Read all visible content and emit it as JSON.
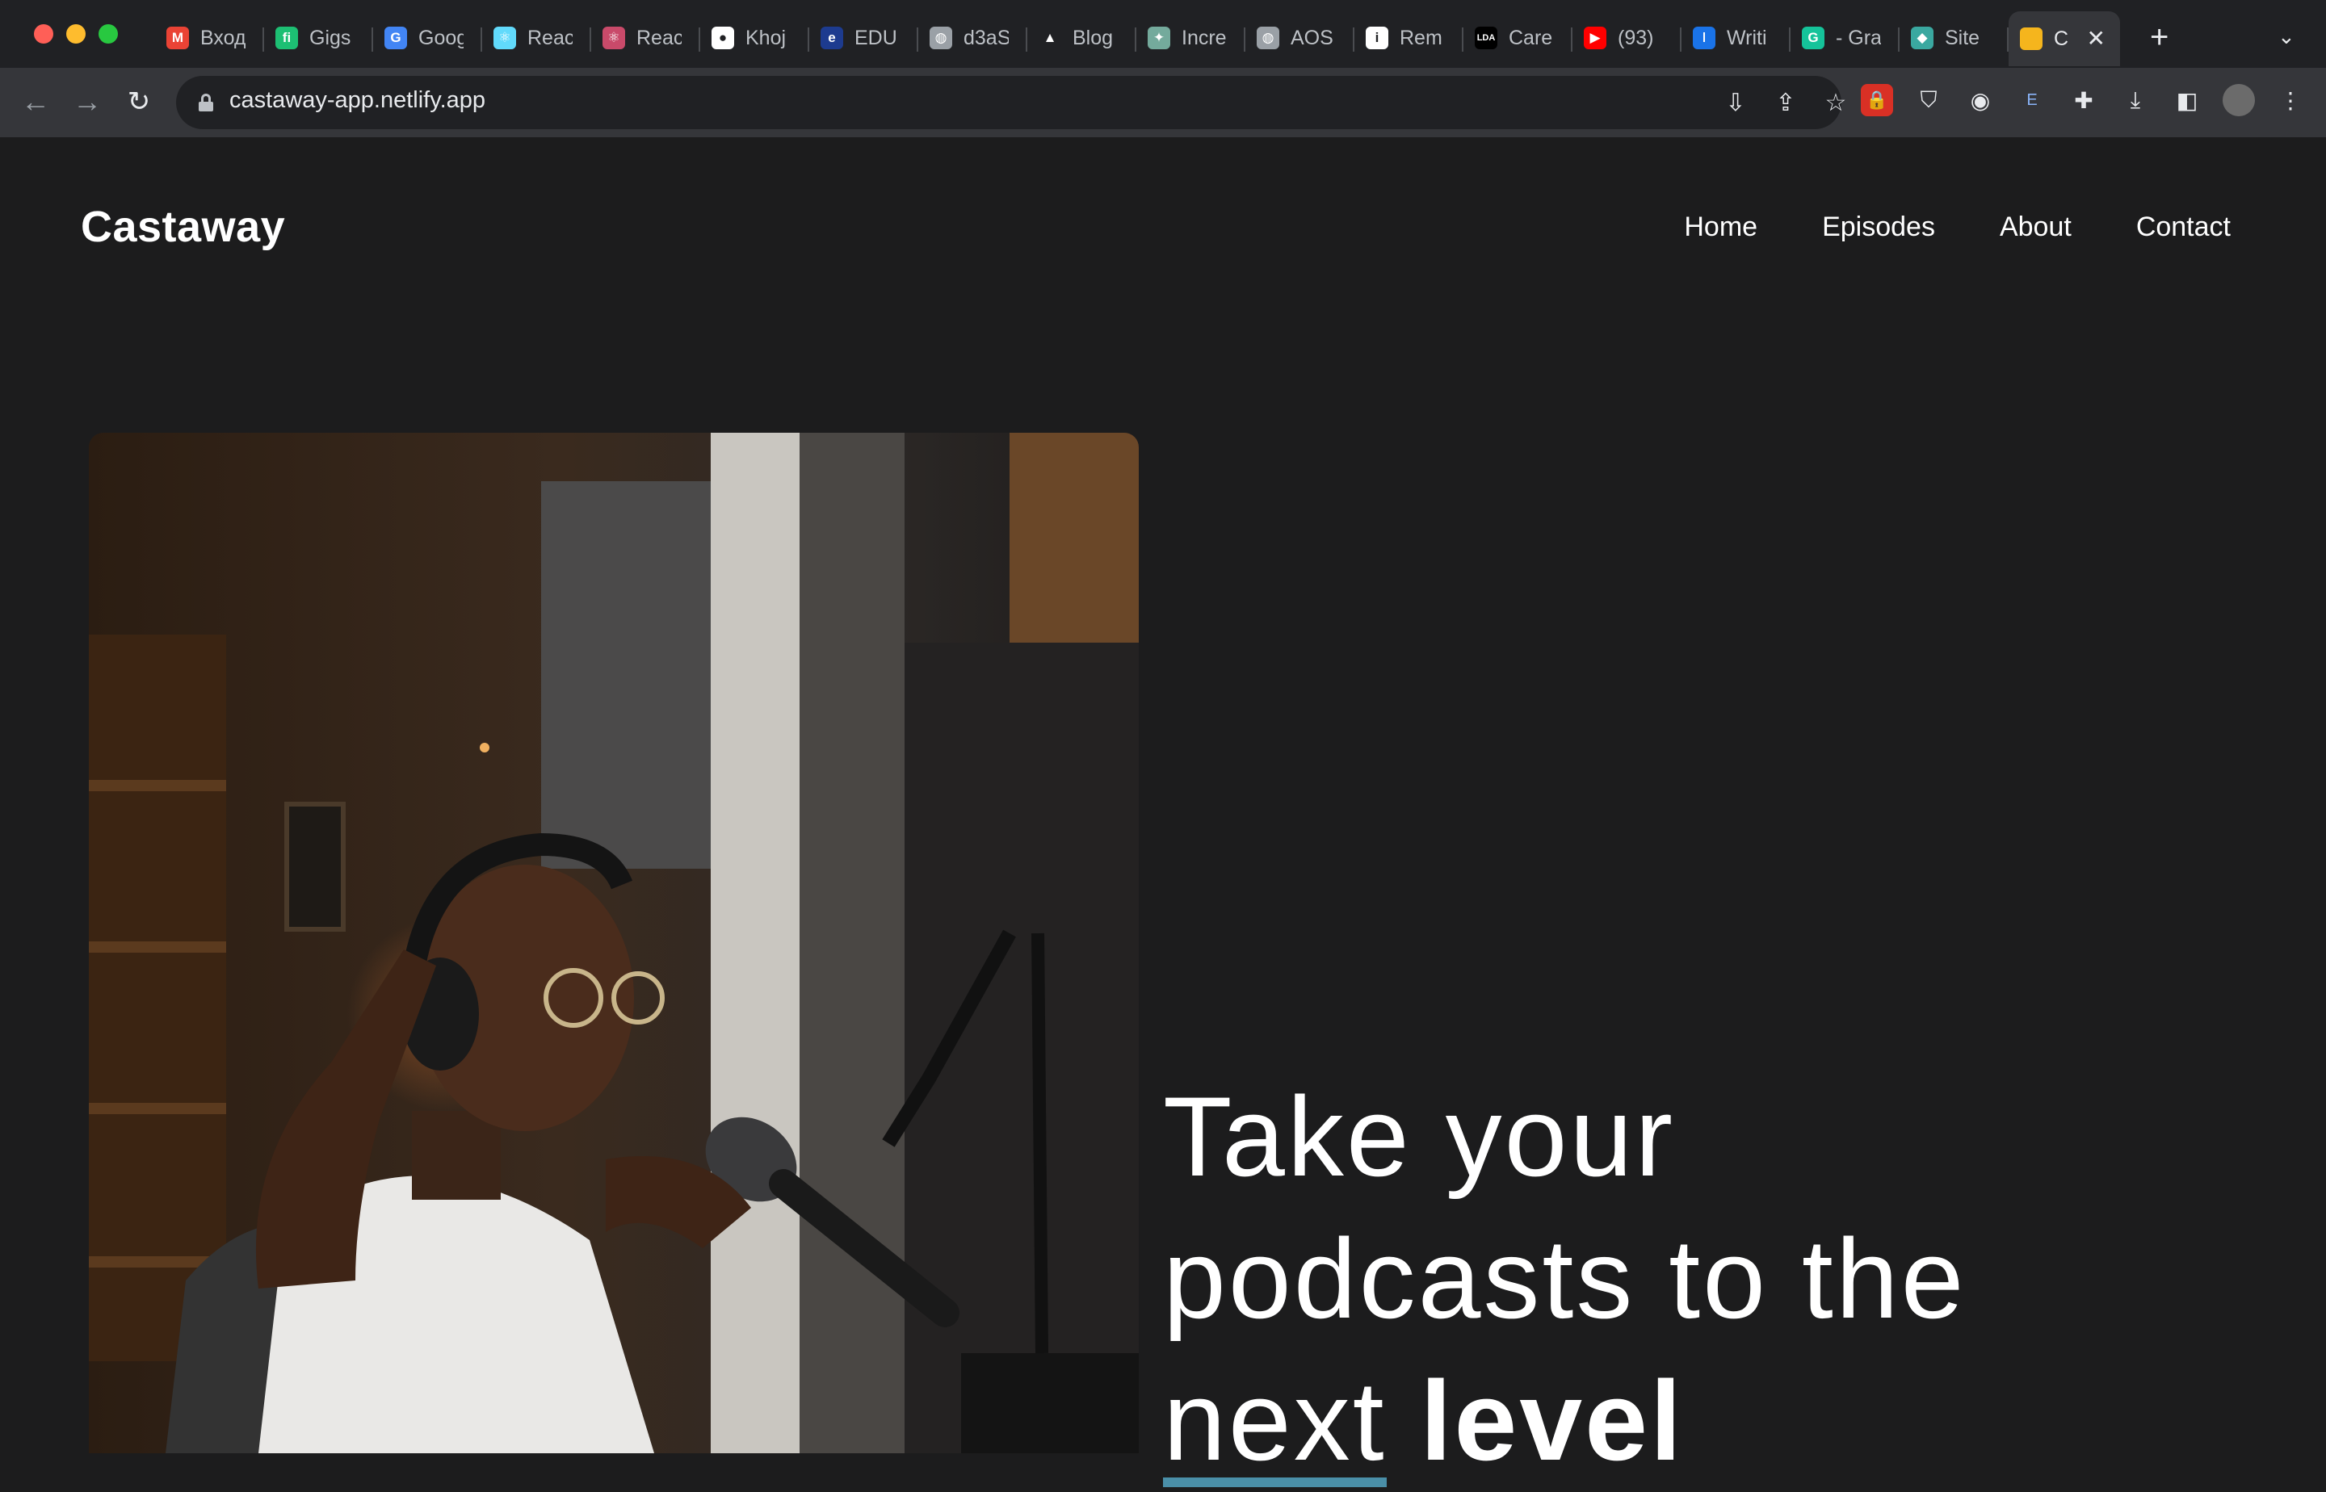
{
  "browser": {
    "tabs": [
      {
        "icon": "gmail-icon",
        "color": "#ea4335",
        "glyph": "M",
        "title": "Вход"
      },
      {
        "icon": "fiverr-icon",
        "color": "#1dbf73",
        "glyph": "fi",
        "title": "Gigs"
      },
      {
        "icon": "google-translate-icon",
        "color": "#4285f4",
        "glyph": "G",
        "title": "Goog"
      },
      {
        "icon": "react-icon",
        "color": "#61dafb",
        "glyph": "⚛",
        "title": "Reac"
      },
      {
        "icon": "react-redux-icon",
        "color": "#c94a6a",
        "glyph": "⚛",
        "title": "Reac"
      },
      {
        "icon": "github-icon",
        "color": "#ffffff",
        "glyph": "●",
        "title": "Khoj"
      },
      {
        "icon": "edu-icon",
        "color": "#1d3b8f",
        "glyph": "e",
        "title": "EDU"
      },
      {
        "icon": "globe-icon",
        "color": "#9aa0a6",
        "glyph": "◍",
        "title": "d3aS"
      },
      {
        "icon": "blog-icon",
        "color": "#202124",
        "glyph": "▲",
        "title": "Blog"
      },
      {
        "icon": "chatgpt-icon",
        "color": "#74aa9c",
        "glyph": "✦",
        "title": "Incre"
      },
      {
        "icon": "globe-icon",
        "color": "#9aa0a6",
        "glyph": "◍",
        "title": "AOS"
      },
      {
        "icon": "info-icon",
        "color": "#ffffff",
        "glyph": "i",
        "title": "Rem"
      },
      {
        "icon": "lda-icon",
        "color": "#000000",
        "glyph": "LDA",
        "title": "Care"
      },
      {
        "icon": "youtube-icon",
        "color": "#ff0000",
        "glyph": "▶",
        "title": "(93)"
      },
      {
        "icon": "writer-icon",
        "color": "#1a73e8",
        "glyph": "ǀ",
        "title": "Writi"
      },
      {
        "icon": "grammarly-icon",
        "color": "#15c39a",
        "glyph": "G",
        "title": "- Gra"
      },
      {
        "icon": "site-icon",
        "color": "#3aa8a0",
        "glyph": "◆",
        "title": "Site"
      }
    ],
    "active_tab": {
      "icon": "castaway-favicon-icon",
      "color": "#f5b51d",
      "title": "C"
    },
    "url": "castaway-app.netlify.app"
  },
  "site": {
    "logo": "Castaway",
    "nav": [
      "Home",
      "Episodes",
      "About",
      "Contact"
    ],
    "headline": {
      "line1": "Take your",
      "line2": "podcasts to the",
      "word_underlined": "next",
      "word_bold": "level"
    },
    "accent_color": "#4a8fa8"
  }
}
